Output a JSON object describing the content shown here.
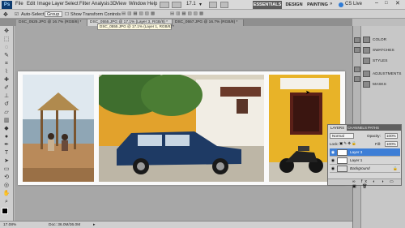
{
  "app_logo": "Ps",
  "menu": [
    "File",
    "Edit",
    "Image",
    "Layer",
    "Select",
    "Filter",
    "Analysis",
    "3D",
    "View",
    "Window",
    "Help"
  ],
  "zoom_selector": "17.1",
  "workspaces": [
    "ESSENTIALS",
    "DESIGN",
    "PAINTING"
  ],
  "cs_live": "CS Live",
  "options_bar": {
    "auto_select_label": "Auto-Select:",
    "auto_select_value": "Group",
    "show_transform": "Show Transform Controls"
  },
  "tabs": [
    "DSC_0525.JPG @ 16.7% (RGB/8) *",
    "DSC_0555.JPG @ 17.1% (Layer 3, RGB/8) *",
    "DSC_0557.JPG @ 16.7% (RGB/8) *"
  ],
  "tooltip": "DSC_0555.JPG @ 17.1% (Layer 1, RGB/8) *",
  "status": {
    "zoom": "17.08%",
    "doc": "Doc: 36.0M/36.0M"
  },
  "dock": {
    "group1": [
      "COLOR",
      "SWATCHES",
      "STYLES"
    ],
    "group2": [
      "ADJUSTMENTS",
      "MASKS"
    ]
  },
  "layers_panel": {
    "tabs": [
      "LAYERS",
      "CHANNELS",
      "PATHS"
    ],
    "blend_mode": "Normal",
    "opacity_label": "Opacity:",
    "opacity": "100%",
    "lock_label": "Lock:",
    "fill_label": "Fill:",
    "fill": "100%",
    "layers": [
      "Layer 3",
      "Layer 1",
      "Background"
    ]
  },
  "colors": {
    "accent": "#3d7ed6",
    "canvas": "#a7a7a7",
    "chrome": "#d0d0d0"
  }
}
